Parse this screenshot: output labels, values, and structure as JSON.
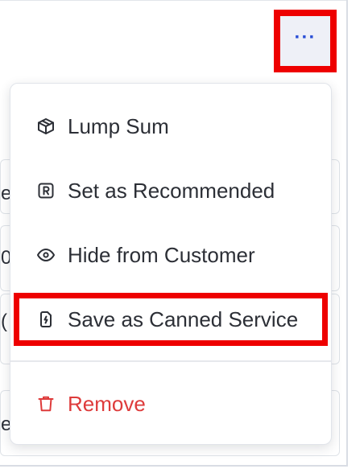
{
  "header": {
    "more_button_label": "···"
  },
  "background_rows": [
    {
      "fragment": "e/"
    },
    {
      "fragment": "0"
    },
    {
      "fragment": "("
    },
    {
      "fragment": "e"
    }
  ],
  "menu": {
    "items": [
      {
        "label": "Lump Sum",
        "icon": "package-icon"
      },
      {
        "label": "Set as Recommended",
        "icon": "r-badge-icon"
      },
      {
        "label": "Hide from Customer",
        "icon": "eye-icon"
      },
      {
        "label": "Save as Canned Service",
        "icon": "canned-service-icon"
      },
      {
        "label": "Remove",
        "icon": "trash-icon"
      }
    ]
  },
  "colors": {
    "accent": "#2a4fd6",
    "danger": "#de3b3b",
    "highlight": "#ee0000",
    "menu_text": "#2c2f36"
  }
}
